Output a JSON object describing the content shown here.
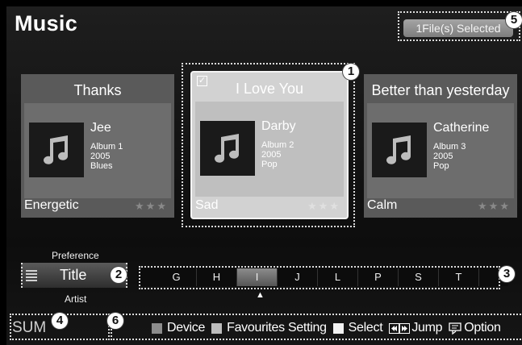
{
  "header": {
    "title": "Music",
    "selection_status": "1File(s) Selected"
  },
  "cards": [
    {
      "title": "Thanks",
      "artist": "Jee",
      "album": "Album 1",
      "year": "2005",
      "genre": "Blues",
      "mood": "Energetic",
      "rating_stars": "★★★",
      "focused": false,
      "checked": false
    },
    {
      "title": "I Love You",
      "artist": "Darby",
      "album": "Album 2",
      "year": "2005",
      "genre": "Pop",
      "mood": "Sad",
      "rating_stars": "★★★",
      "focused": true,
      "checked": true
    },
    {
      "title": "Better than yesterday",
      "artist": "Catherine",
      "album": "Album 3",
      "year": "2005",
      "genre": "Pop",
      "mood": "Calm",
      "rating_stars": "★★★",
      "focused": false,
      "checked": false
    }
  ],
  "sort": {
    "previous": "Preference",
    "current": "Title",
    "next": "Artist"
  },
  "jump_letters": [
    "G",
    "H",
    "I",
    "J",
    "L",
    "P",
    "S",
    "T"
  ],
  "jump_active": "I",
  "footer": {
    "sum_label": "SUM",
    "help": [
      {
        "label": "Device",
        "key_color": "#8c8c8c"
      },
      {
        "label": "Favourites Setting",
        "key_color": "#bdbdbd"
      },
      {
        "label": "Select",
        "key_color": "#f2f2f2"
      },
      {
        "label": "Jump",
        "key_icon": "skip-icon"
      },
      {
        "label": "Option",
        "key_icon": "tools-icon"
      }
    ]
  },
  "callouts": [
    "1",
    "2",
    "3",
    "4",
    "5",
    "6"
  ],
  "icons": {
    "cover_art": "music-note-icon",
    "sort_list": "list-icon"
  }
}
